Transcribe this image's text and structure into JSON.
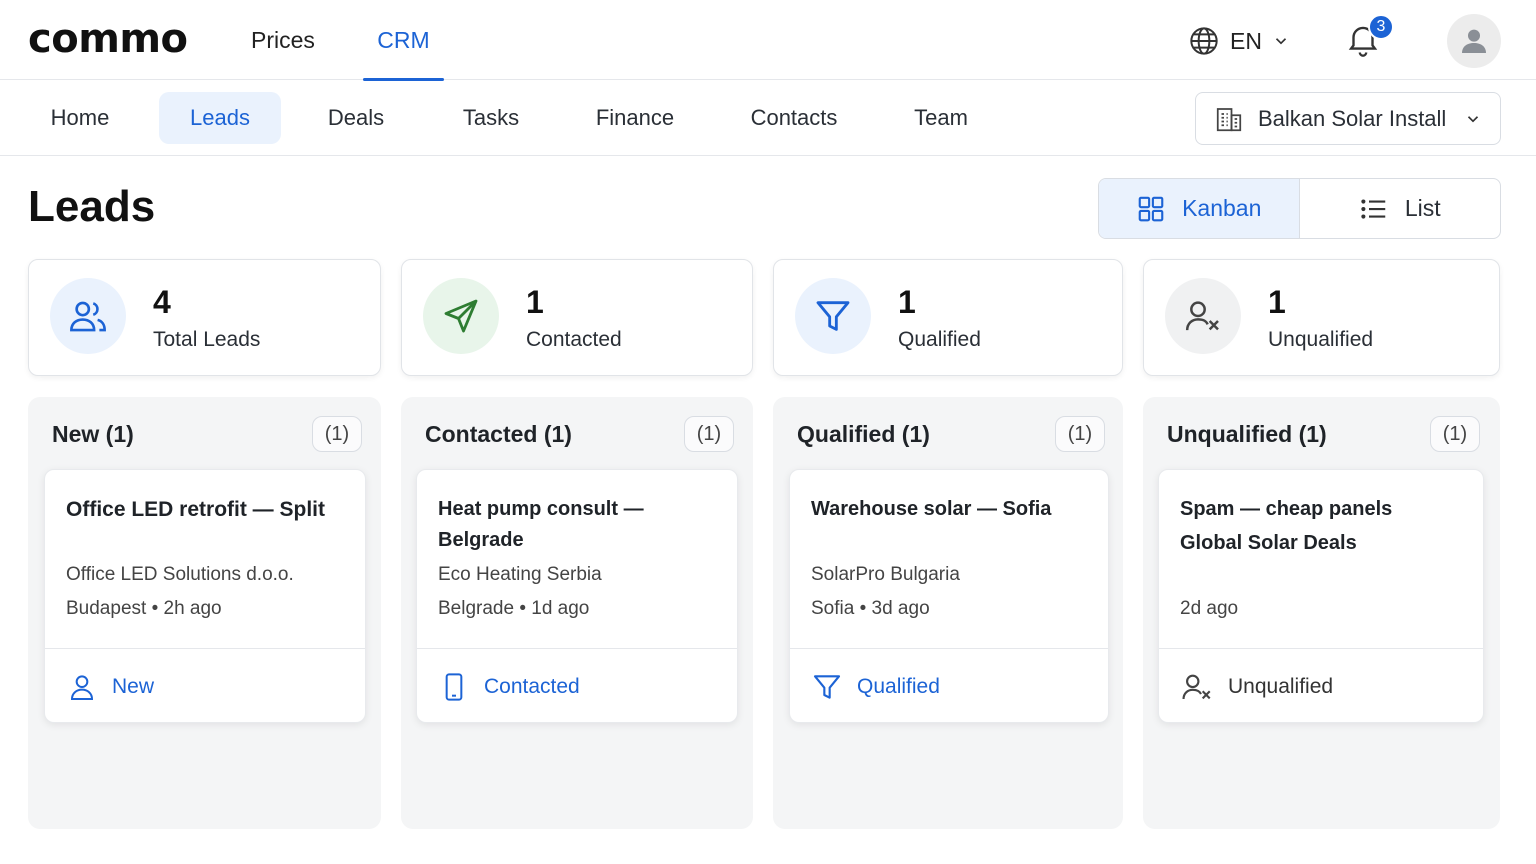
{
  "app": {
    "logo": "commo"
  },
  "top_nav": [
    {
      "label": "Prices",
      "active": false
    },
    {
      "label": "CRM",
      "active": true
    }
  ],
  "header": {
    "language": "EN",
    "notification_count": "3"
  },
  "sub_nav": [
    {
      "label": "Home",
      "active": false
    },
    {
      "label": "Leads",
      "active": true
    },
    {
      "label": "Deals",
      "active": false
    },
    {
      "label": "Tasks",
      "active": false
    },
    {
      "label": "Finance",
      "active": false
    },
    {
      "label": "Contacts",
      "active": false
    },
    {
      "label": "Team",
      "active": false
    }
  ],
  "company_select": {
    "value": "Balkan Solar Install"
  },
  "page": {
    "title": "Leads"
  },
  "view_toggle": {
    "kanban": "Kanban",
    "list": "List",
    "selected": "Kanban"
  },
  "stats": [
    {
      "value": "4",
      "label": "Total Leads",
      "icon": "users-icon"
    },
    {
      "value": "1",
      "label": "Contacted",
      "icon": "send-icon"
    },
    {
      "value": "1",
      "label": "Qualified",
      "icon": "filter-icon"
    },
    {
      "value": "1",
      "label": "Unqualified",
      "icon": "user-x-icon"
    }
  ],
  "columns": [
    {
      "title": "New (1)",
      "count": "(1)",
      "cards": [
        {
          "title": "Office LED retrofit — Split",
          "company": "Office LED Solutions d.o.o.",
          "meta": "Budapest • 2h ago",
          "status": "New",
          "status_icon": "user-icon"
        }
      ]
    },
    {
      "title": "Contacted (1)",
      "count": "(1)",
      "cards": [
        {
          "title": "Heat pump consult — Belgrade",
          "company": "Eco Heating Serbia",
          "meta": "Belgrade • 1d ago",
          "status": "Contacted",
          "status_icon": "phone-icon"
        }
      ]
    },
    {
      "title": "Qualified (1)",
      "count": "(1)",
      "cards": [
        {
          "title": "Warehouse solar — Sofia",
          "company": "SolarPro Bulgaria",
          "meta": "Sofia • 3d ago",
          "status": "Qualified",
          "status_icon": "filter-icon"
        }
      ]
    },
    {
      "title": "Unqualified (1)",
      "count": "(1)",
      "cards": [
        {
          "title": "Spam — cheap panels",
          "company": "Global Solar Deals",
          "meta": "2d ago",
          "status": "Unqualified",
          "status_icon": "user-x-icon"
        }
      ]
    }
  ],
  "colors": {
    "accent": "#1c63d5",
    "accent_bg": "#eaf2fd",
    "contacted_bg": "#e8f5ea",
    "contacted_icon": "#2e7d32"
  }
}
